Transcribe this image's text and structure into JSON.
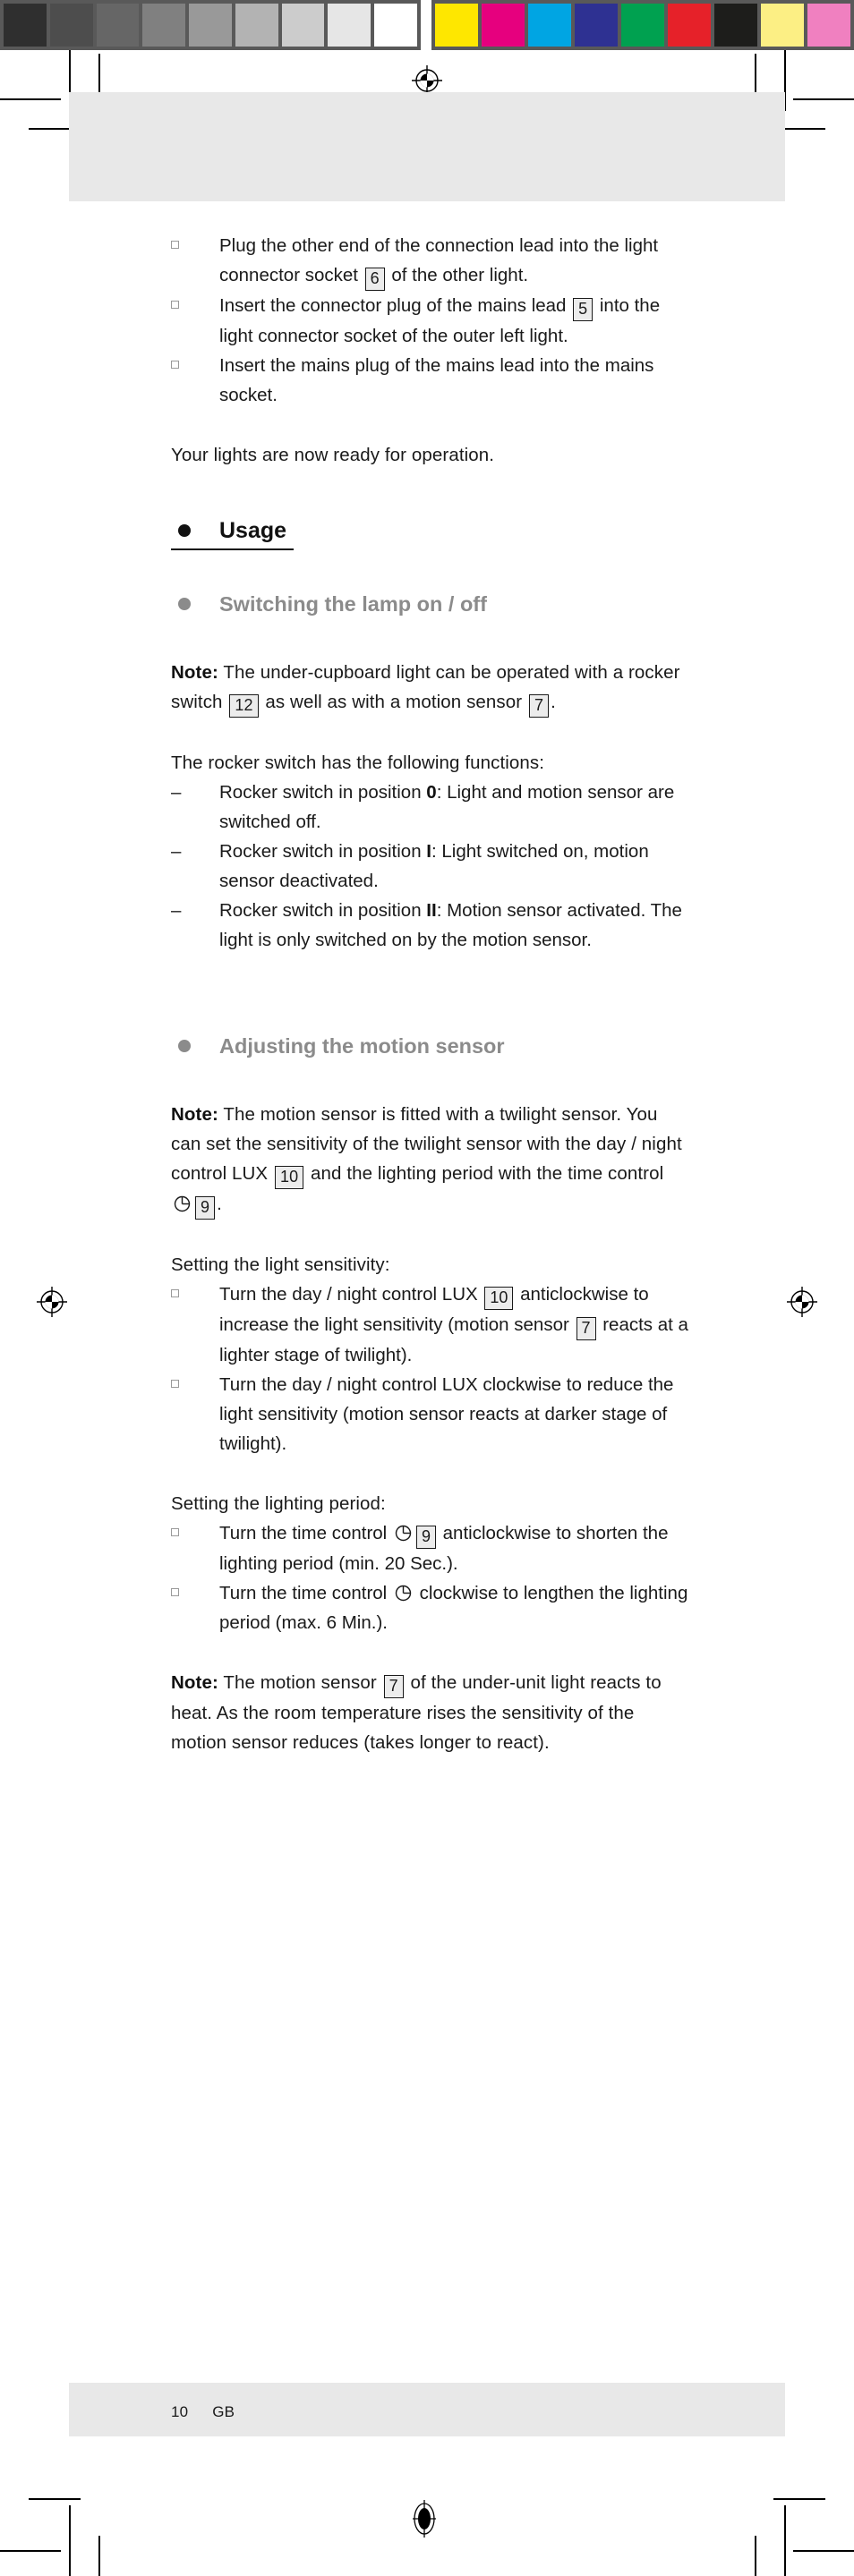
{
  "press": {
    "gray_bar": {
      "name": "grayscale-calibration-bar",
      "swatches": [
        "#2f2f2f",
        "#4d4d4d",
        "#666666",
        "#808080",
        "#999999",
        "#b3b3b3",
        "#cccccc",
        "#e6e6e6",
        "#ffffff"
      ]
    },
    "color_bar": {
      "name": "color-calibration-bar",
      "swatches": [
        "#fee700",
        "#e6007e",
        "#00a5e3",
        "#2e3192",
        "#00a150",
        "#e62129",
        "#1d1d1b",
        "#fcef84",
        "#f080c0"
      ]
    },
    "bar_background": "#595959",
    "registration_mark": "registration-target"
  },
  "page": {
    "band_color": "#e8e8e8",
    "footer": {
      "page_number": "10",
      "language_code": "GB"
    }
  },
  "content": {
    "intro_list": [
      {
        "marker": "square",
        "parts": [
          {
            "t": "text",
            "v": "Plug the other end of the connection lead into the light connector socket "
          },
          {
            "t": "ref",
            "v": "6"
          },
          {
            "t": "text",
            "v": " of the other light."
          }
        ]
      },
      {
        "marker": "square",
        "parts": [
          {
            "t": "text",
            "v": "Insert the connector plug of the mains lead "
          },
          {
            "t": "ref",
            "v": "5"
          },
          {
            "t": "text",
            "v": " into the light connector socket of the outer left light."
          }
        ]
      },
      {
        "marker": "square",
        "parts": [
          {
            "t": "text",
            "v": "Insert the mains plug of the mains lead into the mains socket."
          }
        ]
      }
    ],
    "ready_text": "Your lights are now ready for operation.",
    "heading_usage": "Usage",
    "heading_switching": "Switching the lamp on / off",
    "note_switching": {
      "label": "Note:",
      "parts": [
        {
          "t": "text",
          "v": " The under-cupboard light can be operated with a rocker switch "
        },
        {
          "t": "ref",
          "v": "12"
        },
        {
          "t": "text",
          "v": " as well as with a motion sensor "
        },
        {
          "t": "ref",
          "v": "7"
        },
        {
          "t": "text",
          "v": "."
        }
      ]
    },
    "rocker_lead": "The rocker switch has the following functions:",
    "rocker_list": [
      {
        "marker": "dash",
        "parts": [
          {
            "t": "text",
            "v": "Rocker switch in position "
          },
          {
            "t": "bold",
            "v": "0"
          },
          {
            "t": "text",
            "v": ": Light and motion sensor are switched off."
          }
        ]
      },
      {
        "marker": "dash",
        "parts": [
          {
            "t": "text",
            "v": "Rocker switch in position "
          },
          {
            "t": "bold",
            "v": "I"
          },
          {
            "t": "text",
            "v": ": Light switched on, motion sensor deactivated."
          }
        ]
      },
      {
        "marker": "dash",
        "parts": [
          {
            "t": "text",
            "v": "Rocker switch in position "
          },
          {
            "t": "bold",
            "v": "II"
          },
          {
            "t": "text",
            "v": ": Motion sensor activated. The light is only switched on by the motion sensor."
          }
        ]
      }
    ],
    "heading_adjusting": "Adjusting the motion sensor",
    "note_sensor": {
      "label": "Note:",
      "parts": [
        {
          "t": "text",
          "v": " The motion sensor is fitted with a twilight sensor. You can set the sensitivity of the twilight sensor with the day / night control LUX "
        },
        {
          "t": "ref",
          "v": "10"
        },
        {
          "t": "text",
          "v": " and the lighting period with the time control "
        },
        {
          "t": "clock",
          "v": "clock-icon"
        },
        {
          "t": "ref",
          "v": "9"
        },
        {
          "t": "text",
          "v": "."
        }
      ]
    },
    "sensitivity_lead": "Setting the light sensitivity:",
    "sensitivity_list": [
      {
        "marker": "square",
        "parts": [
          {
            "t": "text",
            "v": "Turn the day / night control LUX "
          },
          {
            "t": "ref",
            "v": "10"
          },
          {
            "t": "text",
            "v": " anticlockwise to increase the light sensitivity (motion sensor "
          },
          {
            "t": "ref",
            "v": "7"
          },
          {
            "t": "text",
            "v": " reacts at a lighter stage of twilight)."
          }
        ]
      },
      {
        "marker": "square",
        "parts": [
          {
            "t": "text",
            "v": "Turn the day / night control LUX clockwise to reduce the light sensitivity (motion sensor reacts at darker stage of twilight)."
          }
        ]
      }
    ],
    "period_lead": "Setting the lighting period:",
    "period_list": [
      {
        "marker": "square",
        "parts": [
          {
            "t": "text",
            "v": "Turn the time control "
          },
          {
            "t": "clock",
            "v": "clock-icon"
          },
          {
            "t": "ref",
            "v": "9"
          },
          {
            "t": "text",
            "v": " anticlockwise to shorten the lighting period (min. 20 Sec.)."
          }
        ]
      },
      {
        "marker": "square",
        "parts": [
          {
            "t": "text",
            "v": "Turn the time control "
          },
          {
            "t": "clock",
            "v": "clock-icon"
          },
          {
            "t": "text",
            "v": " clockwise to lengthen the lighting period (max. 6 Min.)."
          }
        ]
      }
    ],
    "note_heat": {
      "label": "Note:",
      "parts": [
        {
          "t": "text",
          "v": " The motion sensor "
        },
        {
          "t": "ref",
          "v": "7"
        },
        {
          "t": "text",
          "v": " of the under-unit light reacts to heat. As the room temperature rises the sensitivity of the motion sensor reduces (takes longer to react)."
        }
      ]
    }
  }
}
